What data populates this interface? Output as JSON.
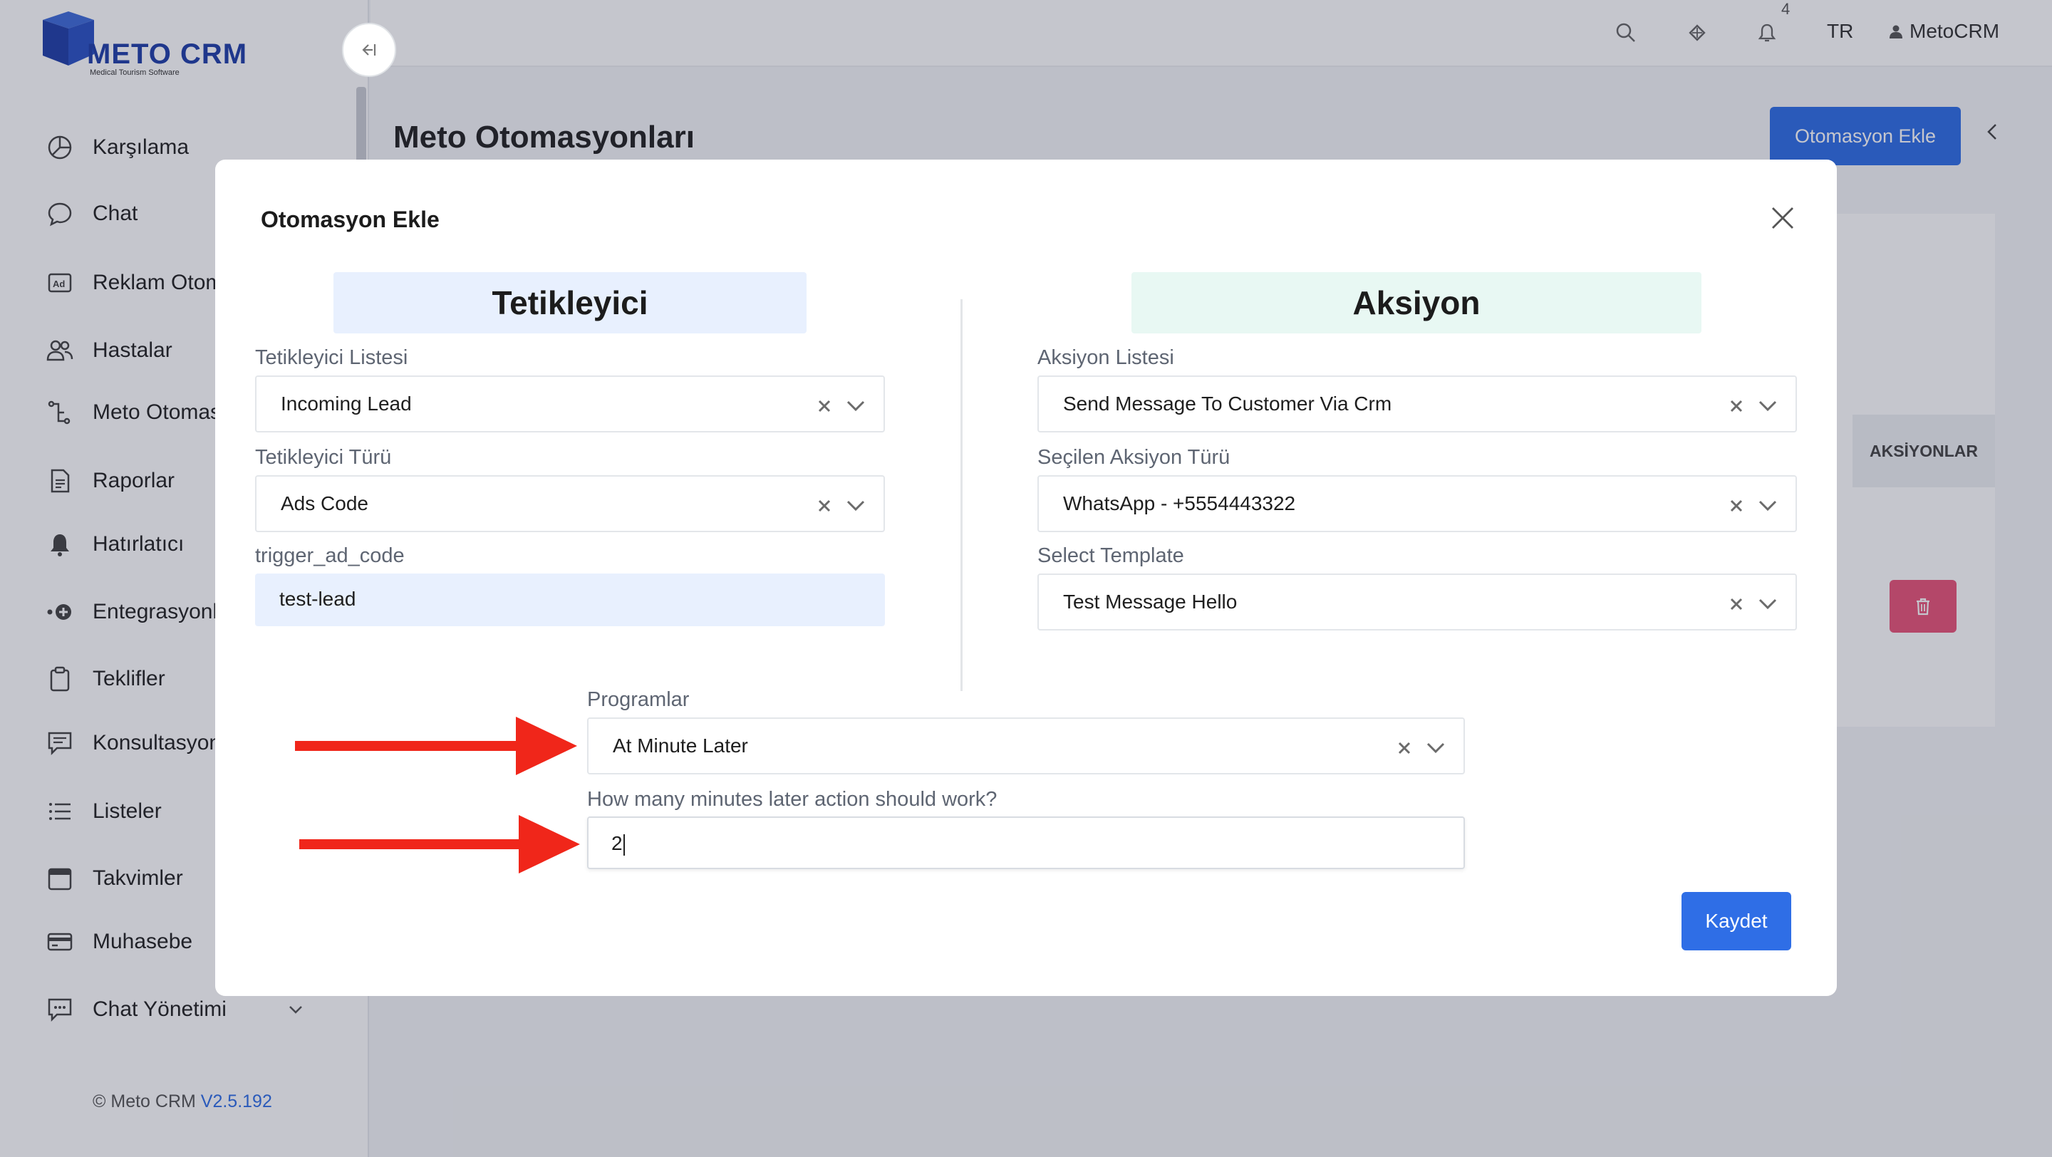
{
  "app": {
    "brand": "METO CRM",
    "tagline": "Medical Tourism Software",
    "version_prefix": "© Meto CRM",
    "version": "V2.5.192"
  },
  "sidebar": {
    "items": [
      {
        "label": "Karşılama",
        "icon": "pie-chart-icon"
      },
      {
        "label": "Chat",
        "icon": "chat-bubble-icon"
      },
      {
        "label": "Reklam Otom",
        "icon": "ad-icon"
      },
      {
        "label": "Hastalar",
        "icon": "users-icon"
      },
      {
        "label": "Meto Otomas",
        "icon": "automation-icon"
      },
      {
        "label": "Raporlar",
        "icon": "report-icon"
      },
      {
        "label": "Hatırlatıcı",
        "icon": "bell-icon"
      },
      {
        "label": "Entegrasyonl",
        "icon": "integration-icon"
      },
      {
        "label": "Teklifler",
        "icon": "clipboard-icon"
      },
      {
        "label": "Konsultasyon",
        "icon": "consultation-icon"
      },
      {
        "label": "Listeler",
        "icon": "list-icon"
      },
      {
        "label": "Takvimler",
        "icon": "calendar-icon"
      },
      {
        "label": "Muhasebe",
        "icon": "credit-card-icon"
      },
      {
        "label": "Chat Yönetimi",
        "icon": "chat-manage-icon"
      }
    ]
  },
  "topbar": {
    "notification_count": "4",
    "language": "TR",
    "user": "MetoCRM"
  },
  "page": {
    "title": "Meto Otomasyonları",
    "add_button": "Otomasyon Ekle",
    "table_header_actions": "AKSİYONLAR"
  },
  "modal": {
    "title": "Otomasyon Ekle",
    "trigger_section": "Tetikleyici",
    "action_section": "Aksiyon",
    "trigger_list_label": "Tetikleyici Listesi",
    "trigger_list_value": "Incoming Lead",
    "trigger_type_label": "Tetikleyici Türü",
    "trigger_type_value": "Ads Code",
    "trigger_ad_code_label": "trigger_ad_code",
    "trigger_ad_code_value": "test-lead",
    "action_list_label": "Aksiyon Listesi",
    "action_list_value": "Send Message To Customer Via Crm",
    "action_type_label": "Seçilen Aksiyon Türü",
    "action_type_value": "WhatsApp - +5554443322",
    "template_label": "Select Template",
    "template_value": "Test Message Hello",
    "schedule_label": "Programlar",
    "schedule_value": "At Minute Later",
    "minutes_label": "How many minutes later action should work?",
    "minutes_value": "2",
    "save_button": "Kaydet"
  },
  "colors": {
    "primary": "#2f6ee6",
    "danger": "#e85478",
    "trigger_header_bg": "#e8f0fe",
    "action_header_bg": "#e8f8f3",
    "annotation_arrow": "#f0261a"
  }
}
